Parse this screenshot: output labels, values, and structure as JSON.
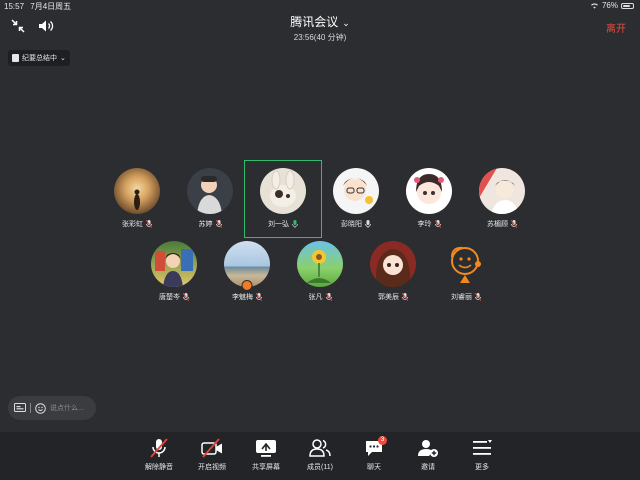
{
  "status": {
    "time": "15:57",
    "date": "7月4日周五",
    "battery": "76%",
    "battery_level": 0.76
  },
  "header": {
    "title": "腾讯会议",
    "subtitle": "23:56(40 分钟)",
    "leave": "离开"
  },
  "summary": {
    "label": "纪要总结中"
  },
  "participants": [
    {
      "name": "张彩虹"
    },
    {
      "name": "苏婷"
    },
    {
      "name": "刘一弘",
      "speaking": true
    },
    {
      "name": "彭晓阳"
    },
    {
      "name": "李玲"
    },
    {
      "name": "苏楣顾"
    },
    {
      "name": "唐楚岑"
    },
    {
      "name": "李魅梅"
    },
    {
      "name": "张凡"
    },
    {
      "name": "郭美辰"
    },
    {
      "name": "刘睿丽"
    }
  ],
  "chat": {
    "placeholder": "说点什么..."
  },
  "toolbar": [
    {
      "label": "解除静音",
      "icon": "mic-muted-icon"
    },
    {
      "label": "开启视频",
      "icon": "camera-off-icon"
    },
    {
      "label": "共享屏幕",
      "icon": "share-screen-icon"
    },
    {
      "label": "成员(11)",
      "icon": "members-icon"
    },
    {
      "label": "聊天",
      "icon": "chat-icon",
      "badge": "3"
    },
    {
      "label": "邀请",
      "icon": "invite-icon"
    },
    {
      "label": "更多",
      "icon": "more-icon"
    }
  ],
  "colors": {
    "background": "#2b2d30",
    "toolbar": "#222427",
    "leave": "#f04a3c",
    "active_speaker": "#2ebd68",
    "muted": "#e0443b"
  }
}
